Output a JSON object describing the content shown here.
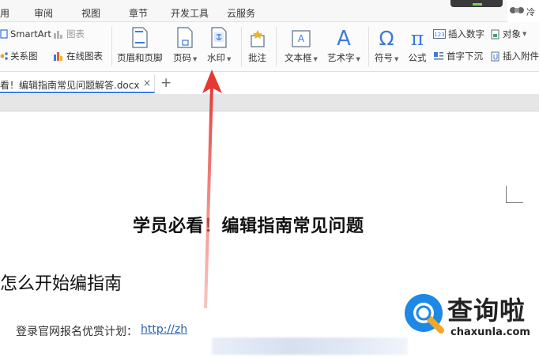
{
  "menubar": {
    "items": [
      "用",
      "审阅",
      "视图",
      "章节",
      "开发工具",
      "云服务"
    ],
    "user_cut": "冷"
  },
  "ribbon": {
    "smartart": "SmartArt",
    "chart": "图表",
    "relation": "关系图",
    "online_chart": "在线图表",
    "header_footer": "页眉和页脚",
    "page_number": "页码",
    "watermark": "水印",
    "comment": "批注",
    "textbox": "文本框",
    "wordart": "艺术字",
    "symbol": "符号",
    "formula": "公式",
    "insert_number": "插入数字",
    "object": "对象",
    "drop_cap": "首字下沉",
    "insert_attachment": "插入附件"
  },
  "tabs": {
    "doc_title": "看！编辑指南常见问题解答.docx",
    "close": "×",
    "new": "+"
  },
  "document": {
    "title": "学员必看！编辑指南常见问题",
    "heading": "怎么开始编指南",
    "reg_label": "登录官网报名优赏计划：",
    "reg_link": "http://zh"
  },
  "watermark_logo": {
    "name": "查询啦",
    "domain": "chaxunla.com"
  },
  "colors": {
    "arrow": "#e53935",
    "accent_blue": "#3a7ee4",
    "logo_blue": "#1e88e5",
    "logo_orange": "#f5a623"
  }
}
